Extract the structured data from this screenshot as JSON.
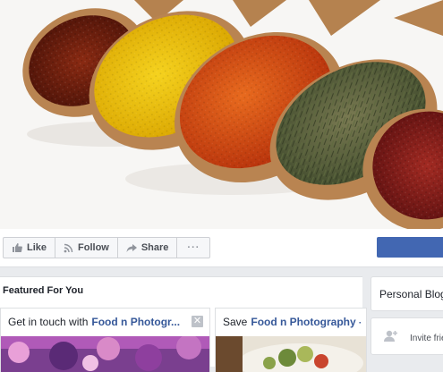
{
  "action_bar": {
    "like_label": "Like",
    "follow_label": "Follow",
    "share_label": "Share",
    "more_label": "···"
  },
  "featured": {
    "title": "Featured For You",
    "cards": [
      {
        "prefix": "Get in touch with",
        "page": "Food n Photogr...",
        "close": "✕"
      },
      {
        "prefix": "Save",
        "page": "Food n Photography -"
      }
    ]
  },
  "sidebar": {
    "section_title": "Personal Blog",
    "invite_label": "Invite frie"
  },
  "colors": {
    "brand_blue": "#4267b2",
    "link_blue": "#365899",
    "background": "#e9ebee"
  },
  "icons": [
    "thumbs-up-icon",
    "rss-icon",
    "share-arrow-icon",
    "more-icon",
    "close-icon",
    "add-friend-icon"
  ]
}
